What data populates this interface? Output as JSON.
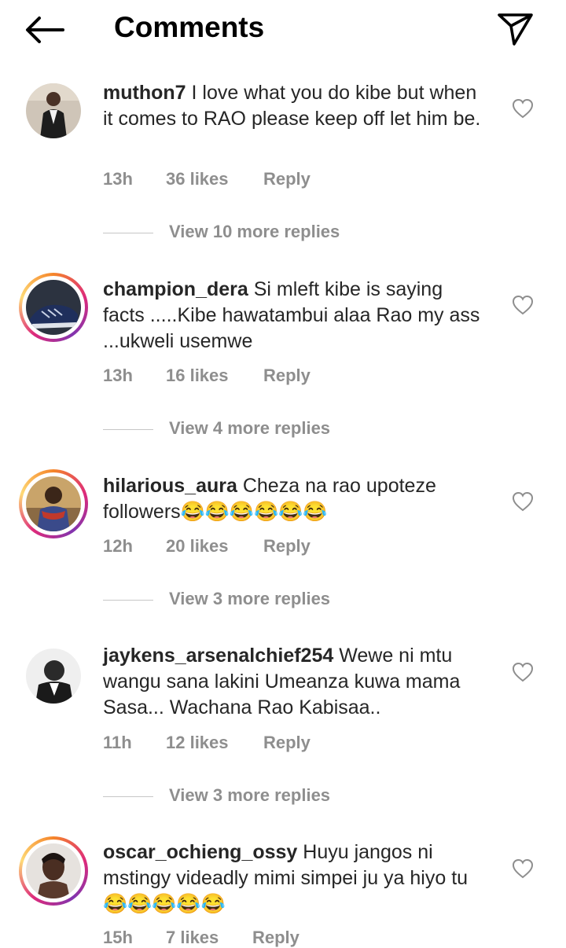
{
  "header": {
    "title": "Comments",
    "back_icon": "arrow-left-icon",
    "share_icon": "paper-plane-icon"
  },
  "comments": [
    {
      "username": "muthon7",
      "text": " I love what you do kibe but when it comes to RAO please keep off let him be.",
      "time": "13h",
      "likes": "36 likes",
      "reply": "Reply",
      "view_replies": "View 10 more replies",
      "story_ring": false
    },
    {
      "username": "champion_dera",
      "text": " Si mleft kibe is saying facts .....Kibe hawatambui alaa Rao my ass ...ukweli usemwe",
      "time": "13h",
      "likes": "16 likes",
      "reply": "Reply",
      "view_replies": "View 4 more replies",
      "story_ring": true
    },
    {
      "username": "hilarious_aura",
      "text": " Cheza na rao upoteze followers😂😂😂😂😂😂",
      "time": "12h",
      "likes": "20 likes",
      "reply": "Reply",
      "view_replies": "View 3 more replies",
      "story_ring": true
    },
    {
      "username": "jaykens_arsenalchief254",
      "text": " Wewe ni mtu wangu sana lakini Umeanza kuwa mama Sasa... Wachana Rao Kabisaa..",
      "time": "11h",
      "likes": "12 likes",
      "reply": "Reply",
      "view_replies": "View 3 more replies",
      "story_ring": false
    },
    {
      "username": "oscar_ochieng_ossy",
      "text": " Huyu jangos ni mstingy videadly mimi simpei ju ya hiyo tu😂😂😂😂😂",
      "time": "15h",
      "likes": "7 likes",
      "reply": "Reply",
      "story_ring": true
    }
  ],
  "colors": {
    "text": "#262626",
    "secondary": "#8e8e8e",
    "divider": "#c7c7c7"
  }
}
